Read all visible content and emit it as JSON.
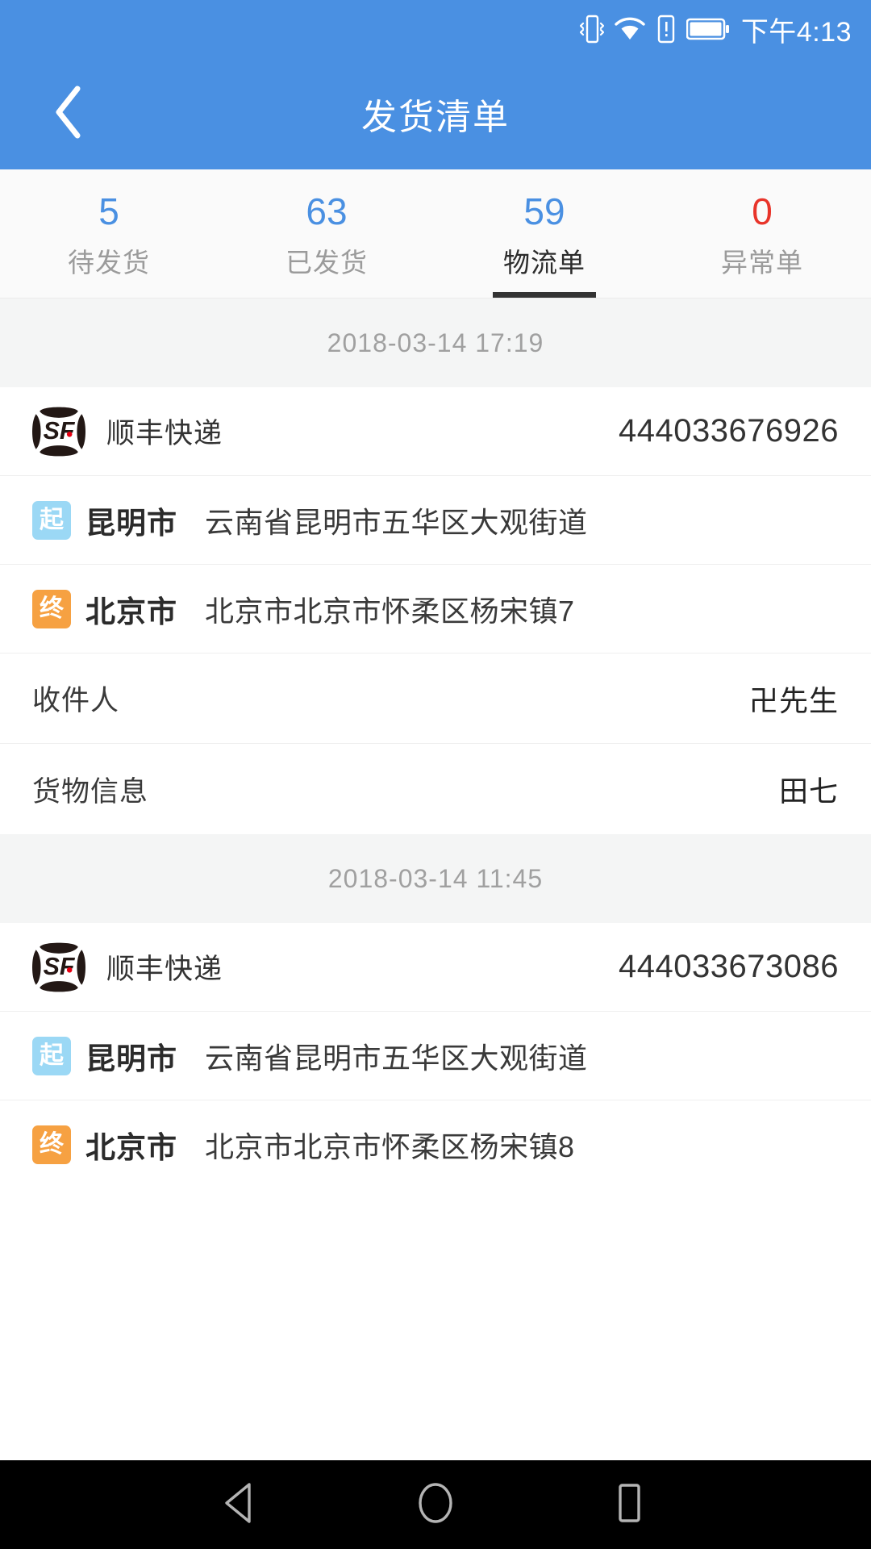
{
  "status_bar": {
    "time": "下午4:13",
    "icons": [
      "vibrate-icon",
      "wifi-icon",
      "sim-card-icon",
      "battery-icon"
    ]
  },
  "app_bar": {
    "title": "发货清单",
    "back_icon": "chevron-left-icon"
  },
  "tabs": [
    {
      "count": "5",
      "label": "待发货",
      "active": false,
      "count_color": "#4a90e2"
    },
    {
      "count": "63",
      "label": "已发货",
      "active": false,
      "count_color": "#4a90e2"
    },
    {
      "count": "59",
      "label": "物流单",
      "active": true,
      "count_color": "#4a90e2"
    },
    {
      "count": "0",
      "label": "异常单",
      "active": false,
      "count_color": "#e8342a"
    }
  ],
  "colors": {
    "brand_blue": "#4a90e2",
    "danger_red": "#e8342a",
    "badge_start": "#9bd8f5",
    "badge_end": "#f6a142",
    "sf_logo": "#231815",
    "sf_dot": "#e60012"
  },
  "shipments": [
    {
      "date": "2018-03-14 17:19",
      "carrier": "顺丰快递",
      "carrier_logo": "sf-express-logo",
      "tracking_no": "444033676926",
      "origin": {
        "badge": "起",
        "city": "昆明市",
        "address": "云南省昆明市五华区大观街道"
      },
      "destination": {
        "badge": "终",
        "city": "北京市",
        "address": "北京市北京市怀柔区杨宋镇7"
      },
      "receiver_label": "收件人",
      "receiver_value": "卍先生",
      "goods_label": "货物信息",
      "goods_value": "田七"
    },
    {
      "date": "2018-03-14 11:45",
      "carrier": "顺丰快递",
      "carrier_logo": "sf-express-logo",
      "tracking_no": "444033673086",
      "origin": {
        "badge": "起",
        "city": "昆明市",
        "address": "云南省昆明市五华区大观街道"
      },
      "destination": {
        "badge": "终",
        "city": "北京市",
        "address": "北京市北京市怀柔区杨宋镇8"
      }
    }
  ],
  "nav_bar": {
    "back": "triangle-back-icon",
    "home": "circle-home-icon",
    "recents": "square-recents-icon"
  }
}
